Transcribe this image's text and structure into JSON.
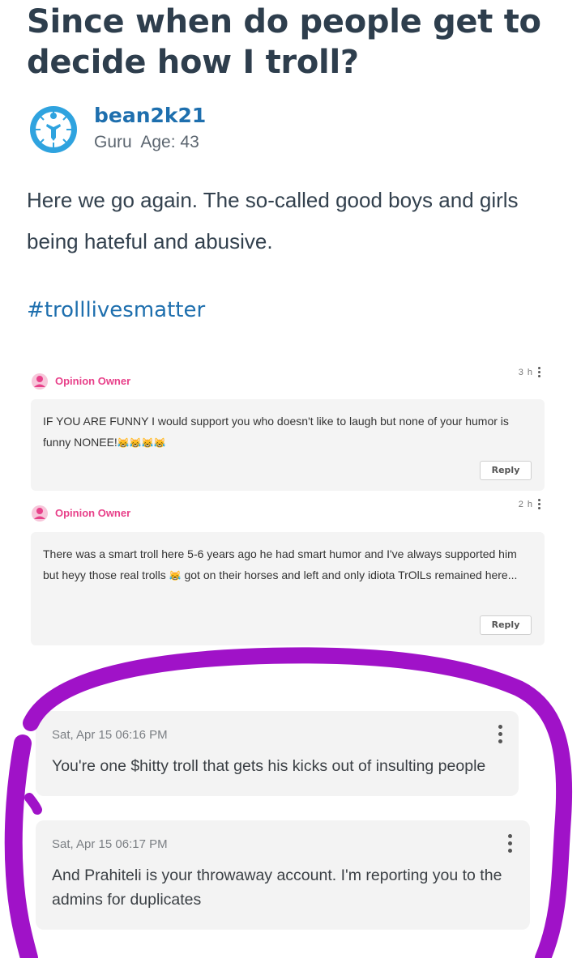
{
  "post": {
    "title": "Since when do people get to decide how I troll?",
    "author": {
      "username": "bean2k21",
      "rank": "Guru",
      "age": "Age: 43"
    },
    "body": "Here we go again. The so-called good boys and girls being hateful and abusive.",
    "hashtag": "#trolllivesmatter"
  },
  "opinions": [
    {
      "owner_label": "Opinion Owner",
      "time": "3 h",
      "text": "IF YOU ARE FUNNY I would support you who doesn't like to laugh but none of your humor is funny NONEE!",
      "emojis": "😹😹😹😹",
      "reply_label": "Reply"
    },
    {
      "owner_label": "Opinion Owner",
      "time": "2 h",
      "text_before": "There was a smart troll here 5-6 years ago he had smart humor and I've always supported him but heyy those real trolls",
      "emoji": "😹",
      "text_after": "got on their horses and left and only idiota TrOlLs remained here...",
      "reply_label": "Reply"
    }
  ],
  "messages": [
    {
      "timestamp": "Sat, Apr 15 06:16 PM",
      "text": "You're one $hitty troll that gets his kicks out of insulting people"
    },
    {
      "timestamp": "Sat, Apr 15 06:17 PM",
      "text": "And Prahiteli is your throwaway account. I'm reporting you to the admins for duplicates"
    }
  ],
  "colors": {
    "title": "#2e3e4d",
    "username": "#1e6fae",
    "hashtag": "#1e6fae",
    "owner_label": "#e8418a",
    "card_bg": "#f4f4f4",
    "marker": "#a012c8"
  },
  "icons": {
    "avatar": "guru-avatar-icon",
    "owner": "opinion-owner-icon",
    "menu": "kebab-menu-icon"
  }
}
